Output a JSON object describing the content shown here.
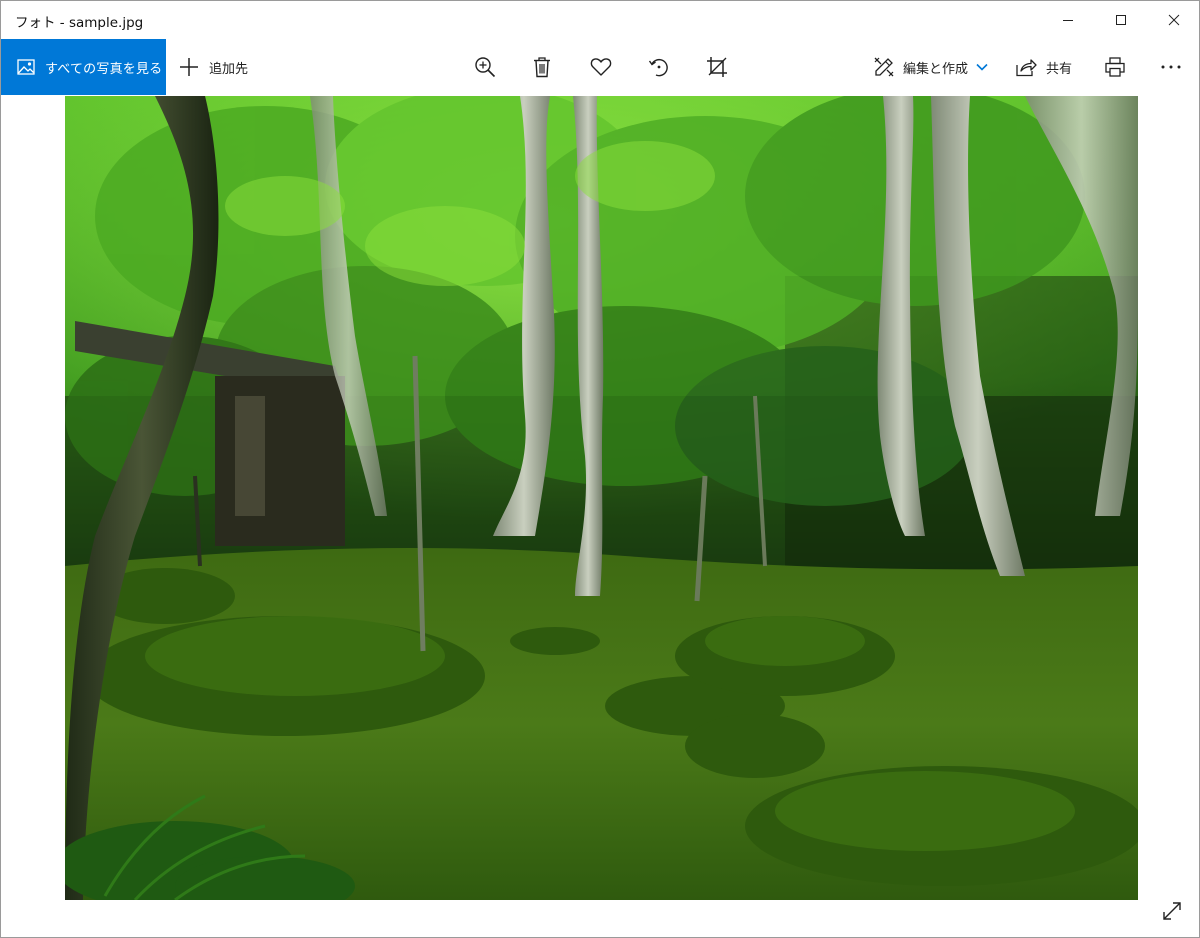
{
  "window": {
    "title": "フォト - sample.jpg"
  },
  "toolbar": {
    "all_photos_label": "すべての写真を見る",
    "add_to_label": "追加先",
    "edit_create_label": "編集と作成",
    "share_label": "共有"
  },
  "icons": {
    "all_photos": "image-icon",
    "add": "plus-icon",
    "zoom": "zoom-in-icon",
    "delete": "trash-icon",
    "favorite": "heart-icon",
    "rotate": "rotate-icon",
    "crop": "crop-icon",
    "edit": "edit-create-icon",
    "edit_dropdown": "chevron-down-icon",
    "share": "share-icon",
    "print": "print-icon",
    "more": "more-icon",
    "fullscreen": "expand-icon"
  },
  "colors": {
    "accent": "#0078d7",
    "toolbar_text": "#222222"
  },
  "photo": {
    "subject": "moss garden forest"
  }
}
